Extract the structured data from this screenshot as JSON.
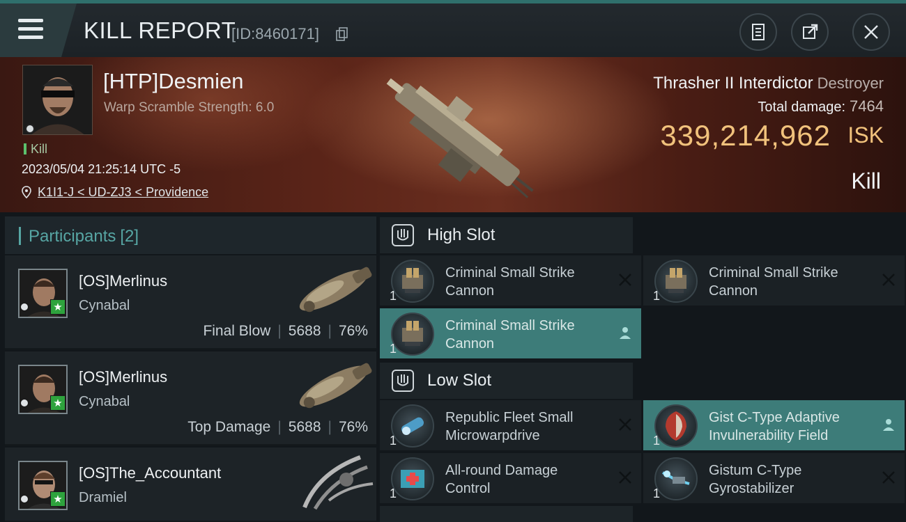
{
  "header": {
    "title": "KILL REPORT",
    "report_id": "[ID:8460171]"
  },
  "victim": {
    "name": "[HTP]Desmien",
    "scramble": "Warp Scramble Strength: 6.0",
    "tag": "Kill",
    "datetime": "2023/05/04 21:25:14 UTC -5",
    "location": "K1I1-J < UD-ZJ3 < Providence",
    "ship_name": "Thrasher II Interdictor",
    "ship_class": "Destroyer",
    "total_damage_label": "Total damage:",
    "total_damage": "7464",
    "isk_value": "339,214,962",
    "isk_unit": "ISK",
    "result": "Kill"
  },
  "participants": {
    "label": "Participants",
    "count": "[2]",
    "items": [
      {
        "name": "[OS]Merlinus",
        "ship": "Cynabal",
        "role": "Final Blow",
        "damage": "5688",
        "percent": "76%"
      },
      {
        "name": "[OS]Merlinus",
        "ship": "Cynabal",
        "role": "Top Damage",
        "damage": "5688",
        "percent": "76%"
      },
      {
        "name": "[OS]The_Accountant",
        "ship": "Dramiel",
        "role": "",
        "damage": "",
        "percent": ""
      }
    ]
  },
  "fitting": {
    "high_slot_label": "High Slot",
    "low_slot_label": "Low Slot",
    "high": [
      {
        "name": "Criminal Small Strike Cannon",
        "qty": "1"
      },
      {
        "name": "Criminal Small Strike Cannon",
        "qty": "1"
      },
      {
        "name": "Criminal Small Strike Cannon",
        "qty": "1"
      }
    ],
    "low": [
      {
        "name": "Republic Fleet Small Microwarpdrive",
        "qty": "1"
      },
      {
        "name": "Gist C-Type Adaptive Invulnerability Field",
        "qty": "1"
      },
      {
        "name": "All-round Damage Control",
        "qty": "1"
      },
      {
        "name": "Gistum C-Type Gyrostabilizer",
        "qty": "1"
      }
    ]
  },
  "colors": {
    "accent_teal": "#3d7c79",
    "isk_gold": "#f1c27c",
    "final_blow_green": "#2ea33d"
  }
}
